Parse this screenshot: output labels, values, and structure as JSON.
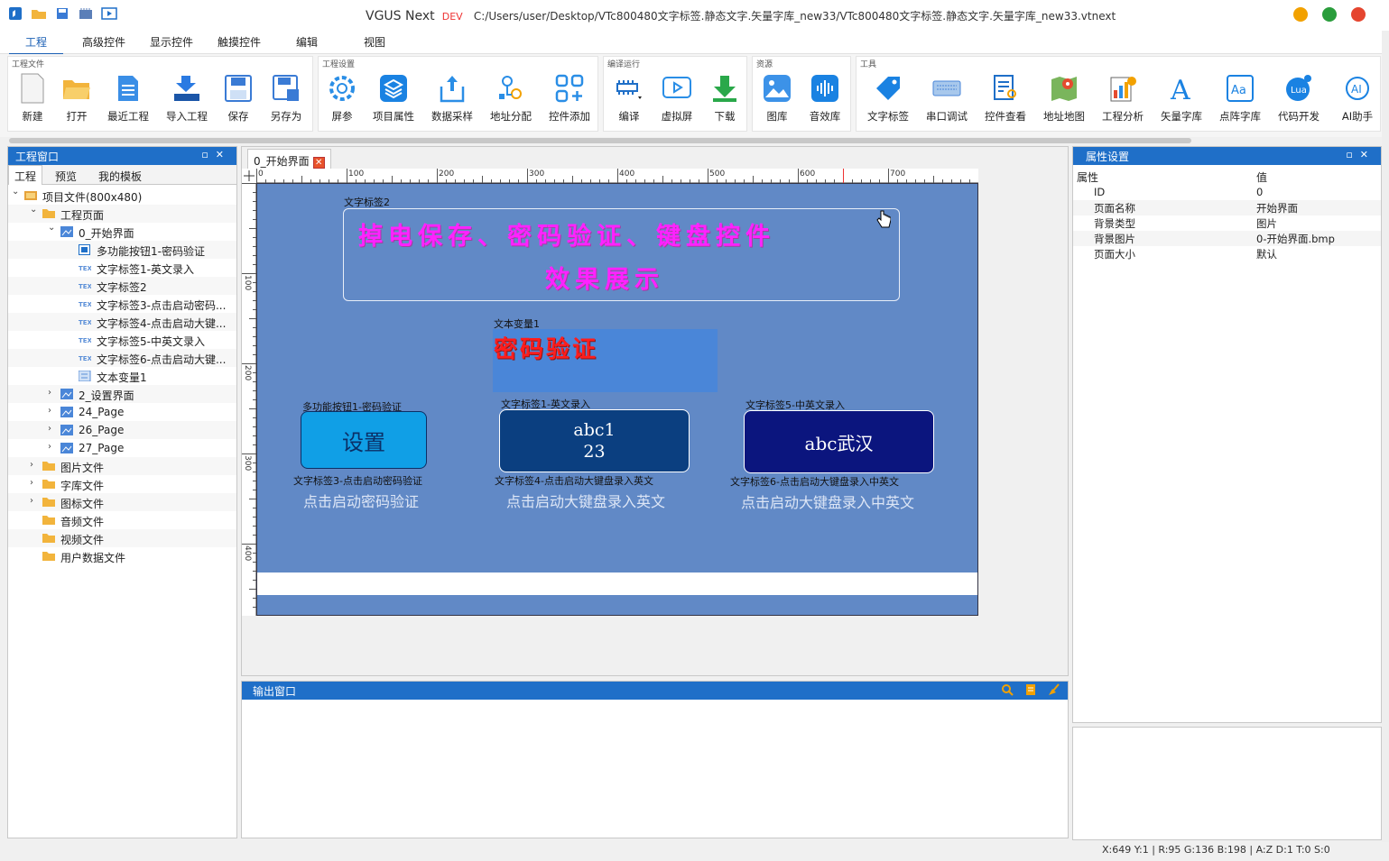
{
  "window": {
    "app_name": "VGUS Next",
    "badge": "DEV",
    "file_path": "C:/Users/user/Desktop/VTc800480文字标签.静态文字.矢量字库_new33/VTc800480文字标签.静态文字.矢量字库_new33.vtnext"
  },
  "menu": {
    "tabs": [
      "工程",
      "高级控件",
      "显示控件",
      "触摸控件",
      "编辑",
      "视图"
    ]
  },
  "ribbon": {
    "groups": [
      {
        "label": "工程文件",
        "items": [
          "新建",
          "打开",
          "最近工程",
          "导入工程",
          "保存",
          "另存为"
        ]
      },
      {
        "label": "工程设置",
        "items": [
          "屏参",
          "项目属性",
          "数据采样",
          "地址分配",
          "控件添加"
        ]
      },
      {
        "label": "编译运行",
        "items": [
          "编译",
          "虚拟屏",
          "下载"
        ]
      },
      {
        "label": "资源",
        "items": [
          "图库",
          "音效库"
        ]
      },
      {
        "label": "工具",
        "items": [
          "文字标签",
          "串口调试",
          "控件查看",
          "地址地图",
          "工程分析",
          "矢量字库",
          "点阵字库",
          "代码开发",
          "AI助手"
        ]
      }
    ]
  },
  "project_panel": {
    "title": "工程窗口",
    "tabs": [
      "工程",
      "预览",
      "我的模板"
    ],
    "tree": [
      {
        "label": "项目文件(800x480)",
        "level": 0,
        "expanded": true,
        "icon": "project-icon"
      },
      {
        "label": "工程页面",
        "level": 1,
        "expanded": true,
        "icon": "folder-icon"
      },
      {
        "label": "0_开始界面",
        "level": 2,
        "expanded": true,
        "icon": "page-icon"
      },
      {
        "label": "多功能按钮1-密码验证",
        "level": 3,
        "icon": "button-icon"
      },
      {
        "label": "文字标签1-英文录入",
        "level": 3,
        "icon": "text-icon"
      },
      {
        "label": "文字标签2",
        "level": 3,
        "icon": "text-icon"
      },
      {
        "label": "文字标签3-点击启动密码...",
        "level": 3,
        "icon": "text-icon"
      },
      {
        "label": "文字标签4-点击启动大键...",
        "level": 3,
        "icon": "text-icon"
      },
      {
        "label": "文字标签5-中英文录入",
        "level": 3,
        "icon": "text-icon"
      },
      {
        "label": "文字标签6-点击启动大键...",
        "level": 3,
        "icon": "text-icon"
      },
      {
        "label": "文本变量1",
        "level": 3,
        "icon": "variable-icon"
      },
      {
        "label": "2_设置界面",
        "level": 2,
        "expanded": false,
        "icon": "page-icon"
      },
      {
        "label": "24_Page",
        "level": 2,
        "expanded": false,
        "icon": "page-icon"
      },
      {
        "label": "26_Page",
        "level": 2,
        "expanded": false,
        "icon": "page-icon"
      },
      {
        "label": "27_Page",
        "level": 2,
        "expanded": false,
        "icon": "page-icon"
      },
      {
        "label": "图片文件",
        "level": 1,
        "expanded": false,
        "icon": "folder-icon"
      },
      {
        "label": "字库文件",
        "level": 1,
        "expanded": false,
        "icon": "folder-icon"
      },
      {
        "label": "图标文件",
        "level": 1,
        "expanded": false,
        "icon": "folder-icon"
      },
      {
        "label": "音频文件",
        "level": 1,
        "icon": "folder-icon"
      },
      {
        "label": "视频文件",
        "level": 1,
        "icon": "folder-icon"
      },
      {
        "label": "用户数据文件",
        "level": 1,
        "icon": "folder-icon"
      }
    ]
  },
  "editor": {
    "doc_tab": "0_开始界面",
    "ruler_top": [
      "0",
      "100",
      "200",
      "300",
      "400",
      "500",
      "600",
      "700"
    ],
    "ruler_left": [
      "100",
      "200",
      "300",
      "400"
    ],
    "canvas": {
      "background": "#6189c6",
      "label2_caption": "文字标签2",
      "label2_line1": "掉电保存、密码验证、键盘控件",
      "label2_line2": "效果展示",
      "var1_caption": "文本变量1",
      "var1_text": "密码验证",
      "btn1_caption": "多功能按钮1-密码验证",
      "btn1_text": "设置",
      "lbl1_caption": "文字标签1-英文录入",
      "lbl1_text_line1": "abc1",
      "lbl1_text_line2": "23",
      "lbl5_caption": "文字标签5-中英文录入",
      "lbl5_text": "abc武汉",
      "lbl3_caption": "文字标签3-点击启动密码验证",
      "lbl3_text": "点击启动密码验证",
      "lbl4_caption": "文字标签4-点击启动大键盘录入英文",
      "lbl4_text": "点击启动大键盘录入英文",
      "lbl6_caption": "文字标签6-点击启动大键盘录入中英文",
      "lbl6_text": "点击启动大键盘录入中英文"
    }
  },
  "output_panel": {
    "title": "输出窗口"
  },
  "properties_panel": {
    "title": "属性设置",
    "col_property": "属性",
    "col_value": "值",
    "rows": [
      {
        "name": "ID",
        "value": "0"
      },
      {
        "name": "页面名称",
        "value": "开始界面"
      },
      {
        "name": "背景类型",
        "value": "图片"
      },
      {
        "name": "背景图片",
        "value": "0-开始界面.bmp"
      },
      {
        "name": "页面大小",
        "value": "默认"
      }
    ]
  },
  "status": {
    "text": "X:649  Y:1  |  R:95 G:136 B:198  |  A:Z  D:1  T:0  S:0"
  },
  "colors": {
    "accent": "#1f6fc8",
    "magenta_text": "#ff22ff",
    "red_text": "#ff1d1d",
    "btn1_bg": "#109fe6",
    "lbl1_bg": "#0b3f80",
    "lbl5_bg": "#0b157e"
  }
}
